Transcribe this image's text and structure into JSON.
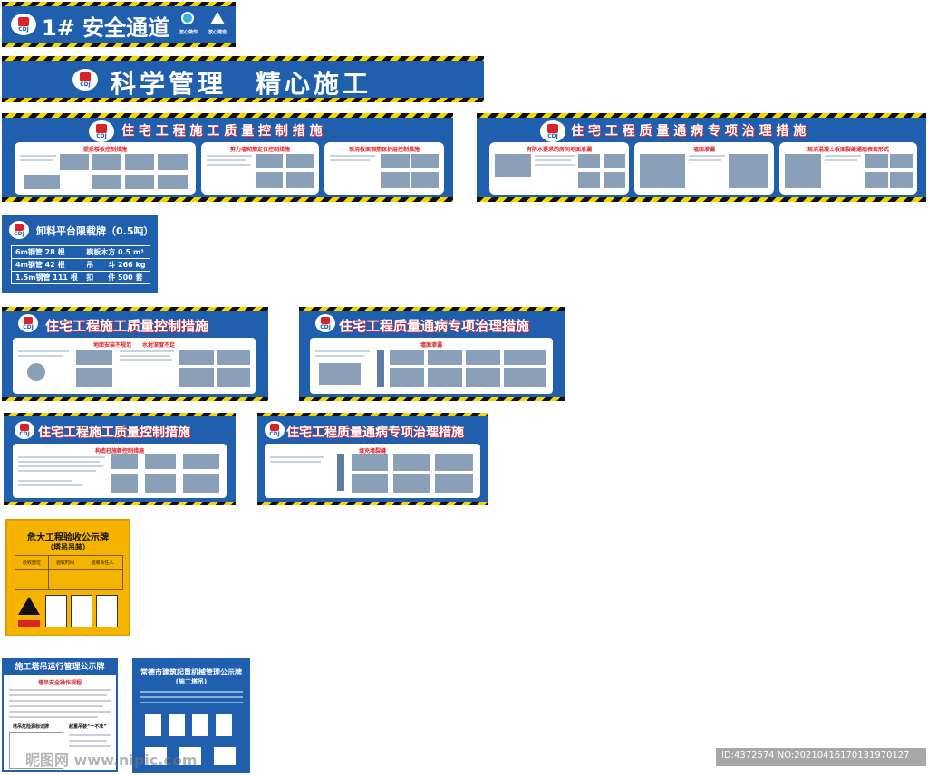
{
  "logo_text": "CDJ",
  "sign1": {
    "title": "1# 安全通道",
    "badges": [
      "放心做作",
      "放心建造"
    ]
  },
  "sign2": {
    "title": "科学管理　精心施工"
  },
  "boards_top": [
    {
      "title": "住 宅 工 程 施 工 质 量 控 制 措 施",
      "cards": [
        "提质楼板控制措施",
        "剪力墙砌筋定位控制措施",
        "现浇板面钢筋保护层控制措施"
      ]
    },
    {
      "title": "住 宅 工 程 质 量 通 病 专 项 治 理 措 施",
      "cards": [
        "有防水要求的房间地面渗漏",
        "墙面渗漏",
        "现浇混凝土板面裂缝通病表现形式"
      ]
    }
  ],
  "load_sign": {
    "title": "卸料平台限载牌（0.5吨）",
    "rows": [
      [
        "6m钢管 28 根",
        "模板木方 0.5 m³"
      ],
      [
        "4m钢管 42 根",
        "吊　　斗 266 kg"
      ],
      [
        "1.5m钢管 111 根",
        "扣　　件 500 套"
      ]
    ]
  },
  "boards_mid": [
    {
      "title": "住宅工程施工质量控制措施",
      "sub": "地面安装不规范　　水封深度不足"
    },
    {
      "title": "住宅工程质量通病专项治理措施",
      "sub": "墙面渗漏"
    }
  ],
  "boards_low": [
    {
      "title": "住宅工程施工质量控制措施",
      "sub": "构造柱施新控制措施"
    },
    {
      "title": "住宅工程质量通病专项治理措施",
      "sub": "填充墙裂缝"
    }
  ],
  "yellow_sign": {
    "title": "危大工程验收公示牌",
    "subtitle": "（塔吊吊装）",
    "headers": [
      "验收部位",
      "验收时间",
      "验收责任人"
    ]
  },
  "tower_sign": {
    "title": "施工塔吊运行管理公示牌",
    "sub1": "塔吊安全操作规程",
    "sub2": "塔吊危险源标识牌",
    "sub3": "起重吊装“十不准”"
  },
  "city_sign": {
    "title": "常德市建筑起重机械管理公示牌",
    "subtitle": "(施工塔吊)"
  },
  "watermark": {
    "left": "昵图网 www.nipic.com",
    "right": "ID:4372574 NO:20210416170131970127"
  },
  "colors": {
    "primary": "#1f5fae",
    "accent": "#d8232a",
    "hazard_yellow": "#f5d400",
    "sign_yellow": "#f4b400"
  }
}
